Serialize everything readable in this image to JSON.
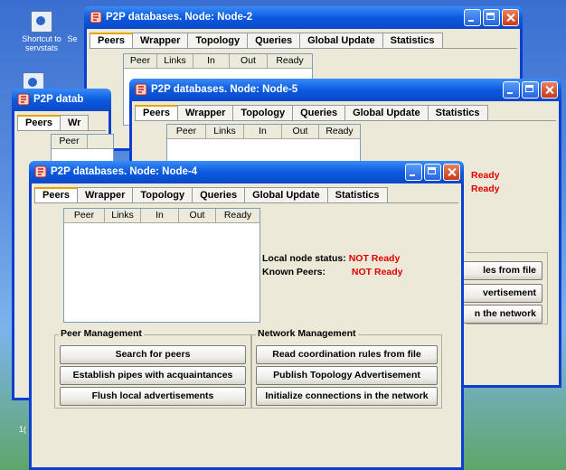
{
  "desktop": {
    "icon1_label": "Shortcut to servstats",
    "icon1_extra": "Se",
    "icon3_label": "1("
  },
  "windows": {
    "node2": {
      "title": "P2P databases. Node: Node-2"
    },
    "node5": {
      "title": "P2P databases. Node: Node-5",
      "ready1": "Ready",
      "ready2": "Ready",
      "btn1": "les from file",
      "btn2": "vertisement",
      "btn3": "n the network"
    },
    "node3": {
      "title": "P2P datab",
      "tab_peers": "Peers",
      "tab_wrapper": "Wr",
      "col_peer": "Peer"
    },
    "node4": {
      "title": "P2P databases. Node: Node-4"
    }
  },
  "tabs": [
    "Peers",
    "Wrapper",
    "Topology",
    "Queries",
    "Global Update",
    "Statistics"
  ],
  "columns": [
    "Peer",
    "Links",
    "In",
    "Out",
    "Ready"
  ],
  "status": {
    "local_label": "Local node status:",
    "local_value": "NOT Ready",
    "known_label": "Known Peers:",
    "known_value": "NOT Ready"
  },
  "peer_management": {
    "title": "Peer Management",
    "search": "Search for peers",
    "establish": "Establish pipes with acquaintances",
    "flush": "Flush local advertisements"
  },
  "network_management": {
    "title": "Network Management",
    "read_rules": "Read coordination rules from file",
    "publish": "Publish Topology Advertisement",
    "initialize": "Initialize connections in the network"
  },
  "colors": {
    "titlebar": "#0a48c8",
    "status_red": "#e00000",
    "active_tab": "#e8a200"
  }
}
